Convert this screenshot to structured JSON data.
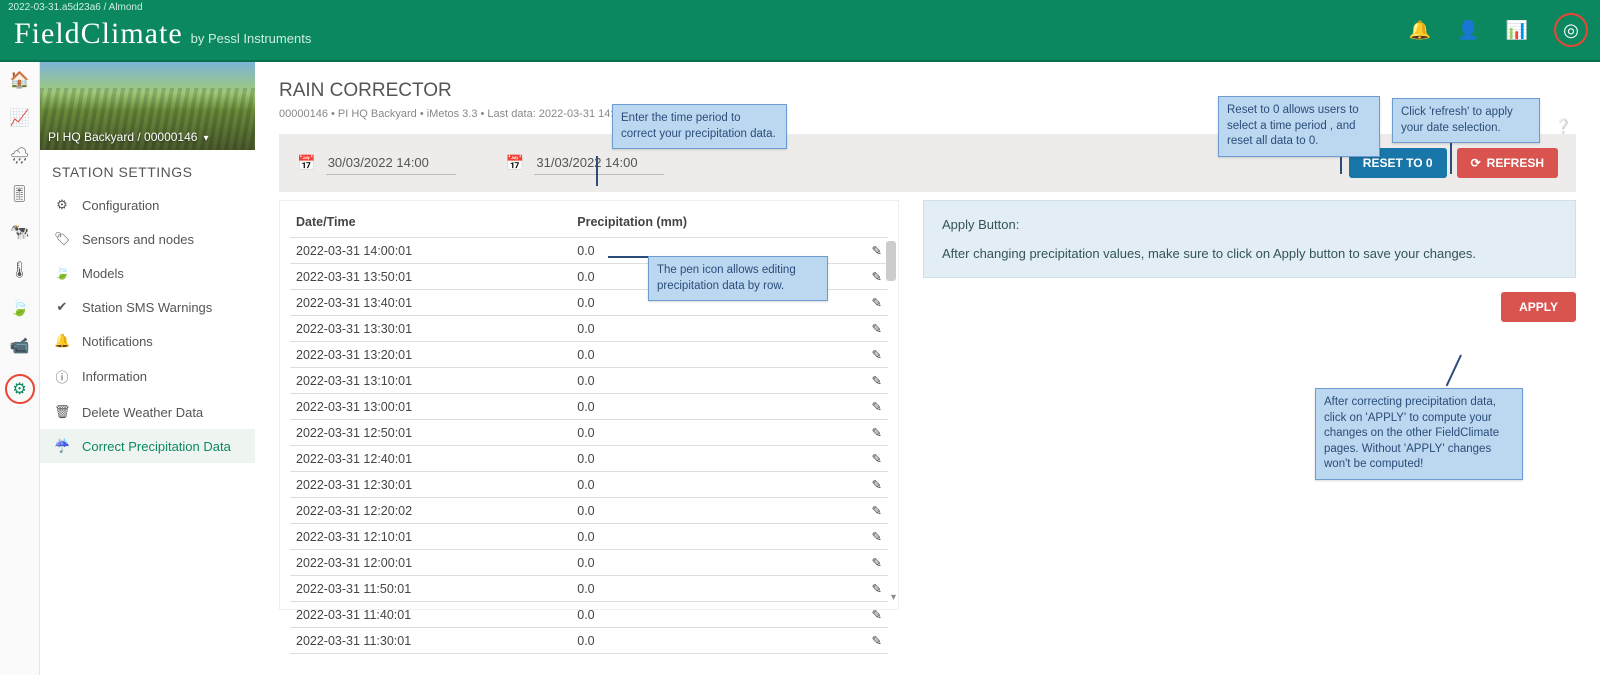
{
  "build": "2022-03-31.a5d23a6 / Almond",
  "brand": {
    "name": "FieldClimate",
    "byline": "by Pessl Instruments"
  },
  "topIcons": [
    "bell",
    "user",
    "dashboard",
    "radar"
  ],
  "station": {
    "name": "PI HQ Backyard",
    "id": "00000146"
  },
  "sidebar": {
    "title": "STATION SETTINGS",
    "items": [
      {
        "icon": "⚙",
        "label": "Configuration"
      },
      {
        "icon": "🏷",
        "label": "Sensors and nodes"
      },
      {
        "icon": "🍃",
        "label": "Models"
      },
      {
        "icon": "✔",
        "label": "Station SMS Warnings"
      },
      {
        "icon": "🔔",
        "label": "Notifications"
      },
      {
        "icon": "ⓘ",
        "label": "Information"
      },
      {
        "icon": "🗑",
        "label": "Delete Weather Data"
      },
      {
        "icon": "☔",
        "label": "Correct Precipitation Data",
        "active": true
      }
    ]
  },
  "page": {
    "title": "RAIN CORRECTOR",
    "subtitle": "00000146 • PI HQ Backyard • iMetos 3.3 • Last data: 2022-03-31 14:00:01"
  },
  "toolbar": {
    "from": "30/03/2022 14:00",
    "to": "31/03/2022 14:00",
    "reset": "RESET TO 0",
    "refresh": "REFRESH"
  },
  "table": {
    "headers": [
      "Date/Time",
      "Precipitation (mm)",
      ""
    ],
    "rows": [
      {
        "dt": "2022-03-31 14:00:01",
        "val": "0.0"
      },
      {
        "dt": "2022-03-31 13:50:01",
        "val": "0.0"
      },
      {
        "dt": "2022-03-31 13:40:01",
        "val": "0.0"
      },
      {
        "dt": "2022-03-31 13:30:01",
        "val": "0.0"
      },
      {
        "dt": "2022-03-31 13:20:01",
        "val": "0.0"
      },
      {
        "dt": "2022-03-31 13:10:01",
        "val": "0.0"
      },
      {
        "dt": "2022-03-31 13:00:01",
        "val": "0.0"
      },
      {
        "dt": "2022-03-31 12:50:01",
        "val": "0.0"
      },
      {
        "dt": "2022-03-31 12:40:01",
        "val": "0.0"
      },
      {
        "dt": "2022-03-31 12:30:01",
        "val": "0.0"
      },
      {
        "dt": "2022-03-31 12:20:02",
        "val": "0.0"
      },
      {
        "dt": "2022-03-31 12:10:01",
        "val": "0.0"
      },
      {
        "dt": "2022-03-31 12:00:01",
        "val": "0.0"
      },
      {
        "dt": "2022-03-31 11:50:01",
        "val": "0.0"
      },
      {
        "dt": "2022-03-31 11:40:01",
        "val": "0.0"
      },
      {
        "dt": "2022-03-31 11:30:01",
        "val": "0.0"
      }
    ]
  },
  "info": {
    "title": "Apply Button:",
    "body": "After changing precipitation values, make sure to click on Apply button to save your changes.",
    "apply": "APPLY"
  },
  "annotations": {
    "dates": "Enter the time period to correct your precipitation data.",
    "reset": "Reset to 0 allows users to select a time period , and reset all data to 0.",
    "refresh": "Click 'refresh' to apply your date selection.",
    "pen": "The pen icon allows editing precipitation data by row.",
    "apply": "After correcting precipitation data, click on 'APPLY' to compute your changes on the other FieldClimate pages. Without 'APPLY' changes won't be computed!"
  }
}
